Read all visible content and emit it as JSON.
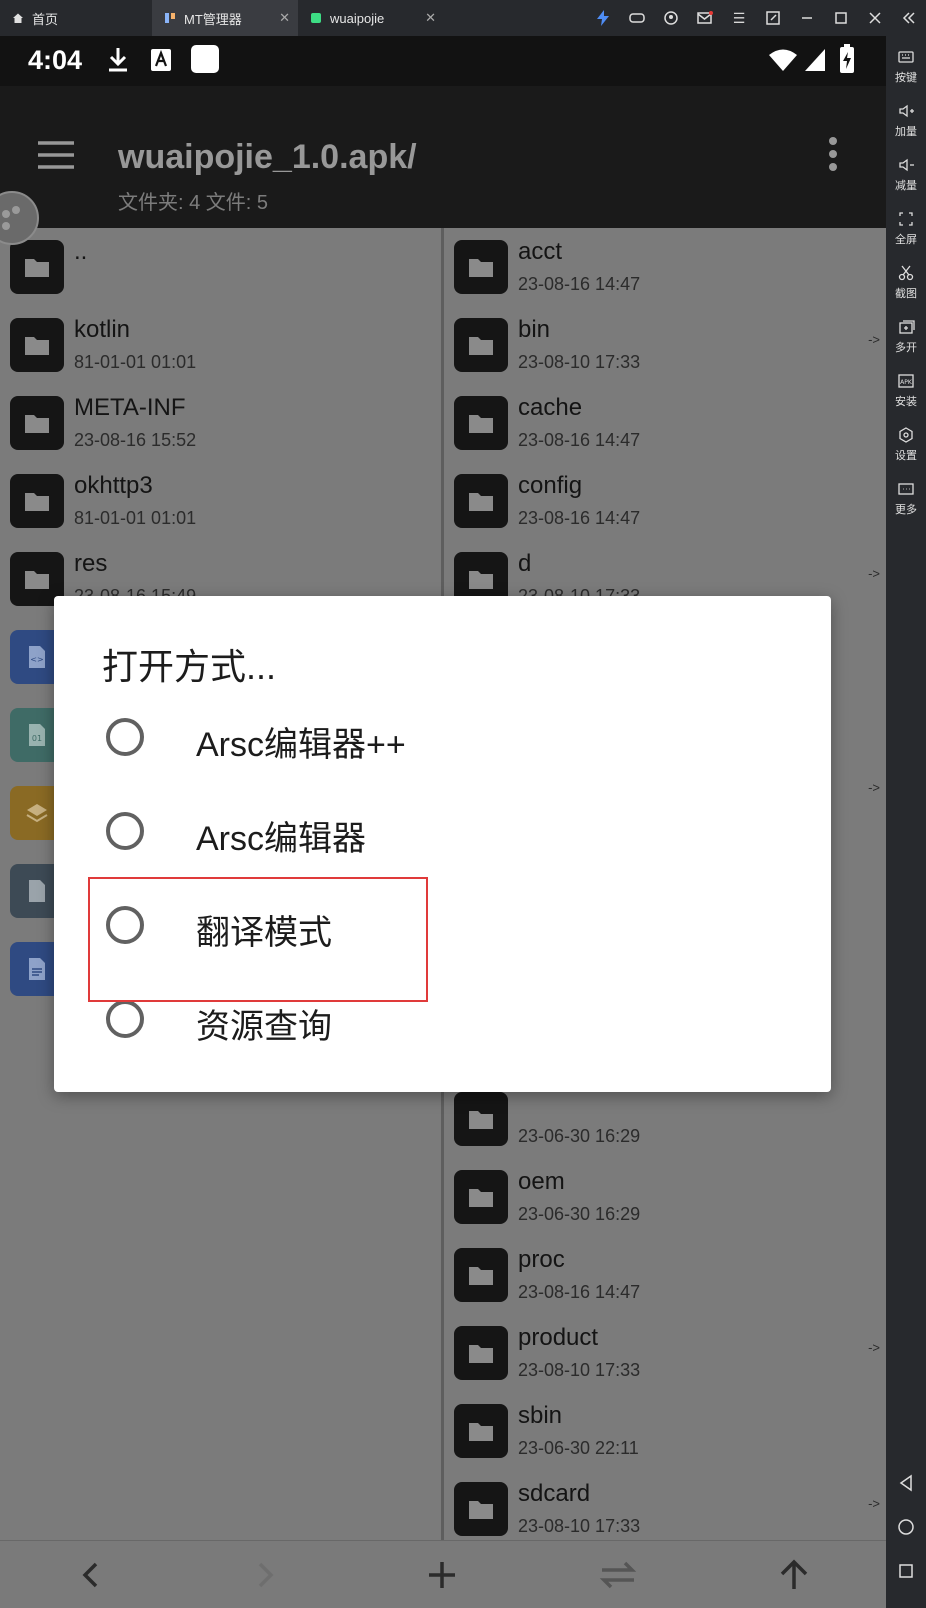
{
  "window": {
    "tabs": [
      {
        "label": "首页",
        "icon": "home-icon"
      },
      {
        "label": "MT管理器",
        "icon": "app-icon"
      },
      {
        "label": "wuaipojie",
        "icon": "android-icon"
      }
    ]
  },
  "sidebar": {
    "items": [
      {
        "label": "按键",
        "icon": "keyboard-icon"
      },
      {
        "label": "加量",
        "icon": "volume-up-icon"
      },
      {
        "label": "减量",
        "icon": "volume-down-icon"
      },
      {
        "label": "全屏",
        "icon": "fullscreen-icon"
      },
      {
        "label": "截图",
        "icon": "scissors-icon"
      },
      {
        "label": "多开",
        "icon": "multi-instance-icon"
      },
      {
        "label": "安装",
        "icon": "apk-icon"
      },
      {
        "label": "设置",
        "icon": "settings-icon"
      },
      {
        "label": "更多",
        "icon": "more-icon"
      }
    ]
  },
  "statusbar": {
    "time": "4:04"
  },
  "appbar": {
    "title": "wuaipojie_1.0.apk/",
    "subtitle": "文件夹: 4  文件: 5"
  },
  "left_pane": {
    "rows": [
      {
        "name": "..",
        "date": ""
      },
      {
        "name": "kotlin",
        "date": "81-01-01 01:01"
      },
      {
        "name": "META-INF",
        "date": "23-08-16 15:52"
      },
      {
        "name": "okhttp3",
        "date": "81-01-01 01:01"
      },
      {
        "name": "res",
        "date": "23-08-16 15:49"
      }
    ]
  },
  "right_pane": {
    "rows": [
      {
        "name": "acct",
        "date": "23-08-16 14:47",
        "arrow": ""
      },
      {
        "name": "bin",
        "date": "23-08-10 17:33",
        "arrow": "->"
      },
      {
        "name": "cache",
        "date": "23-08-16 14:47",
        "arrow": ""
      },
      {
        "name": "config",
        "date": "23-08-16 14:47",
        "arrow": ""
      },
      {
        "name": "d",
        "date": "23-08-10 17:33",
        "arrow": "->"
      }
    ],
    "lower_rows": [
      {
        "name": "",
        "date": "23-06-30 16:29",
        "arrow": ""
      },
      {
        "name": "oem",
        "date": "23-06-30 16:29",
        "arrow": ""
      },
      {
        "name": "proc",
        "date": "23-08-16 14:47",
        "arrow": ""
      },
      {
        "name": "product",
        "date": "23-08-10 17:33",
        "arrow": "->"
      },
      {
        "name": "sbin",
        "date": "23-06-30 22:11",
        "arrow": ""
      },
      {
        "name": "sdcard",
        "date": "23-08-10 17:33",
        "arrow": "->"
      }
    ],
    "hidden_arrow": "->"
  },
  "dialog": {
    "title": "打开方式...",
    "options": [
      {
        "label": "Arsc编辑器++"
      },
      {
        "label": "Arsc编辑器"
      },
      {
        "label": "翻译模式"
      },
      {
        "label": "资源查询"
      }
    ]
  },
  "colors": {
    "highlight": "#e03a3a",
    "dim_overlay": "#7a7a7a"
  }
}
